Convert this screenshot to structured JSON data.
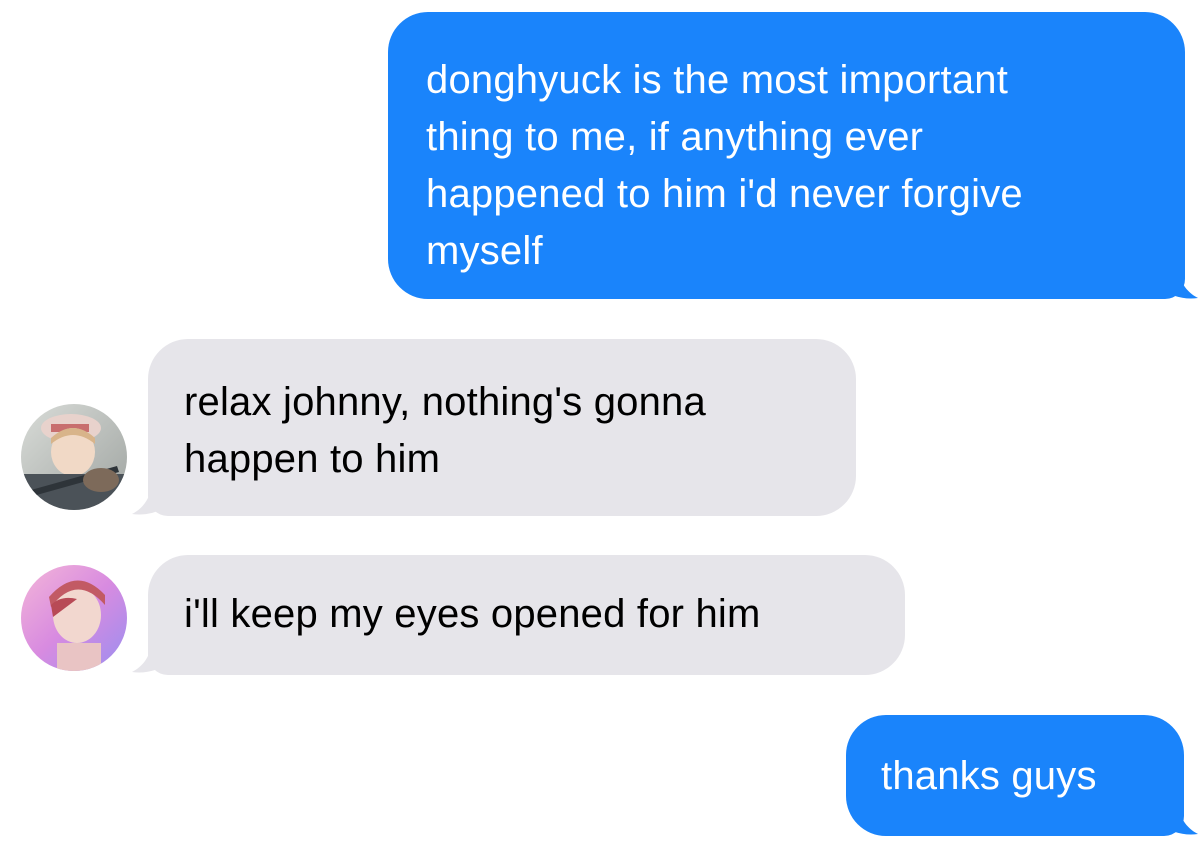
{
  "conversation": {
    "messages": [
      {
        "direction": "sent",
        "text": "donghyuck is the most important\nthing to me, if anything ever\nhappened to him i'd never forgive\nmyself"
      },
      {
        "direction": "received",
        "sender_avatar": "avatar-photo-guitar",
        "text": "relax johnny, nothing's gonna\nhappen to him"
      },
      {
        "direction": "received",
        "sender_avatar": "avatar-photo-pink",
        "text": "i'll keep my eyes opened for him"
      },
      {
        "direction": "sent",
        "text": "thanks guys"
      }
    ]
  },
  "colors": {
    "sent_bubble": "#1a84fb",
    "received_bubble": "#e6e5ea",
    "background": "#ffffff"
  }
}
